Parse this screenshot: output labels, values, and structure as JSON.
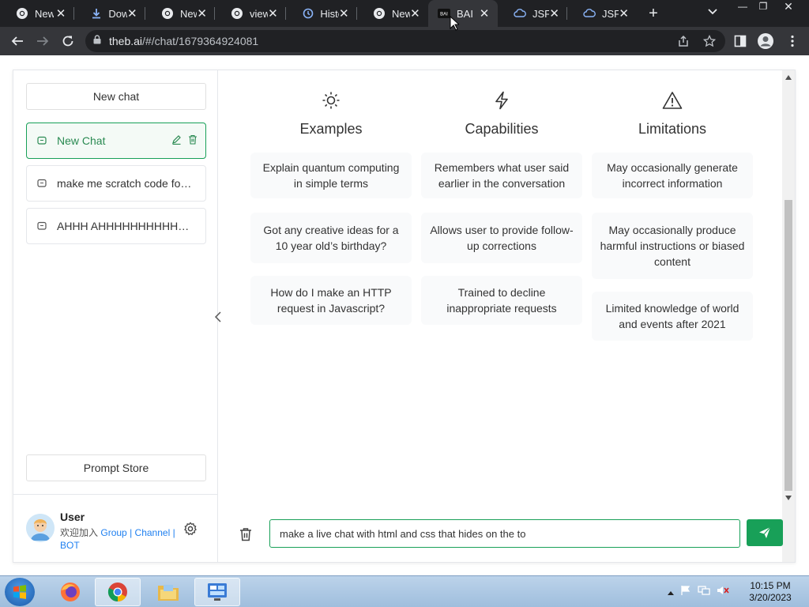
{
  "browser": {
    "tabs": [
      {
        "title": "New",
        "icon": "chrome-icon"
      },
      {
        "title": "Dow",
        "icon": "download-icon"
      },
      {
        "title": "New",
        "icon": "chrome-icon"
      },
      {
        "title": "view",
        "icon": "chrome-icon"
      },
      {
        "title": "Histo",
        "icon": "history-icon"
      },
      {
        "title": "New",
        "icon": "chrome-icon"
      },
      {
        "title": "BAI (",
        "icon": "bai-icon",
        "active": true
      },
      {
        "title": "JSFic",
        "icon": "jsfiddle-icon"
      },
      {
        "title": "JSFic",
        "icon": "jsfiddle-icon"
      }
    ],
    "url_host": "theb.ai",
    "url_path": "/#/chat/1679364924081"
  },
  "sidebar": {
    "new_chat_label": "New chat",
    "chats": [
      {
        "title": "New Chat",
        "active": true
      },
      {
        "title": "make me scratch code for a g..."
      },
      {
        "title": "AHHH AHHHHHHHHHHHHHHHHH..."
      }
    ],
    "prompt_store_label": "Prompt Store",
    "user": {
      "name": "User",
      "desc_prefix": "欢迎加入",
      "link_group": "Group",
      "sep": "|",
      "link_channel": "Channel",
      "sep2": "|",
      "link_bot": "BOT"
    }
  },
  "columns": [
    {
      "title": "Examples",
      "icon": "sun-icon",
      "cards": [
        "Explain quantum computing in simple terms",
        "Got any creative ideas for a 10 year old’s birthday?",
        "How do I make an HTTP request in Javascript?"
      ]
    },
    {
      "title": "Capabilities",
      "icon": "lightning-icon",
      "cards": [
        "Remembers what user said earlier in the conversation",
        "Allows user to provide follow-up corrections",
        "Trained to decline inappropriate requests"
      ]
    },
    {
      "title": "Limitations",
      "icon": "warning-icon",
      "cards": [
        "May occasionally generate incorrect information",
        "May occasionally produce harmful instructions or biased content",
        "Limited knowledge of world and events after 2021"
      ]
    }
  ],
  "input": {
    "value": "make a live chat with html and css that hides on the to"
  },
  "taskbar": {
    "time": "10:15 PM",
    "date": "3/20/2023"
  },
  "colors": {
    "accent": "#18a058",
    "link": "#2080f0",
    "chrome_dark": "#202124"
  }
}
